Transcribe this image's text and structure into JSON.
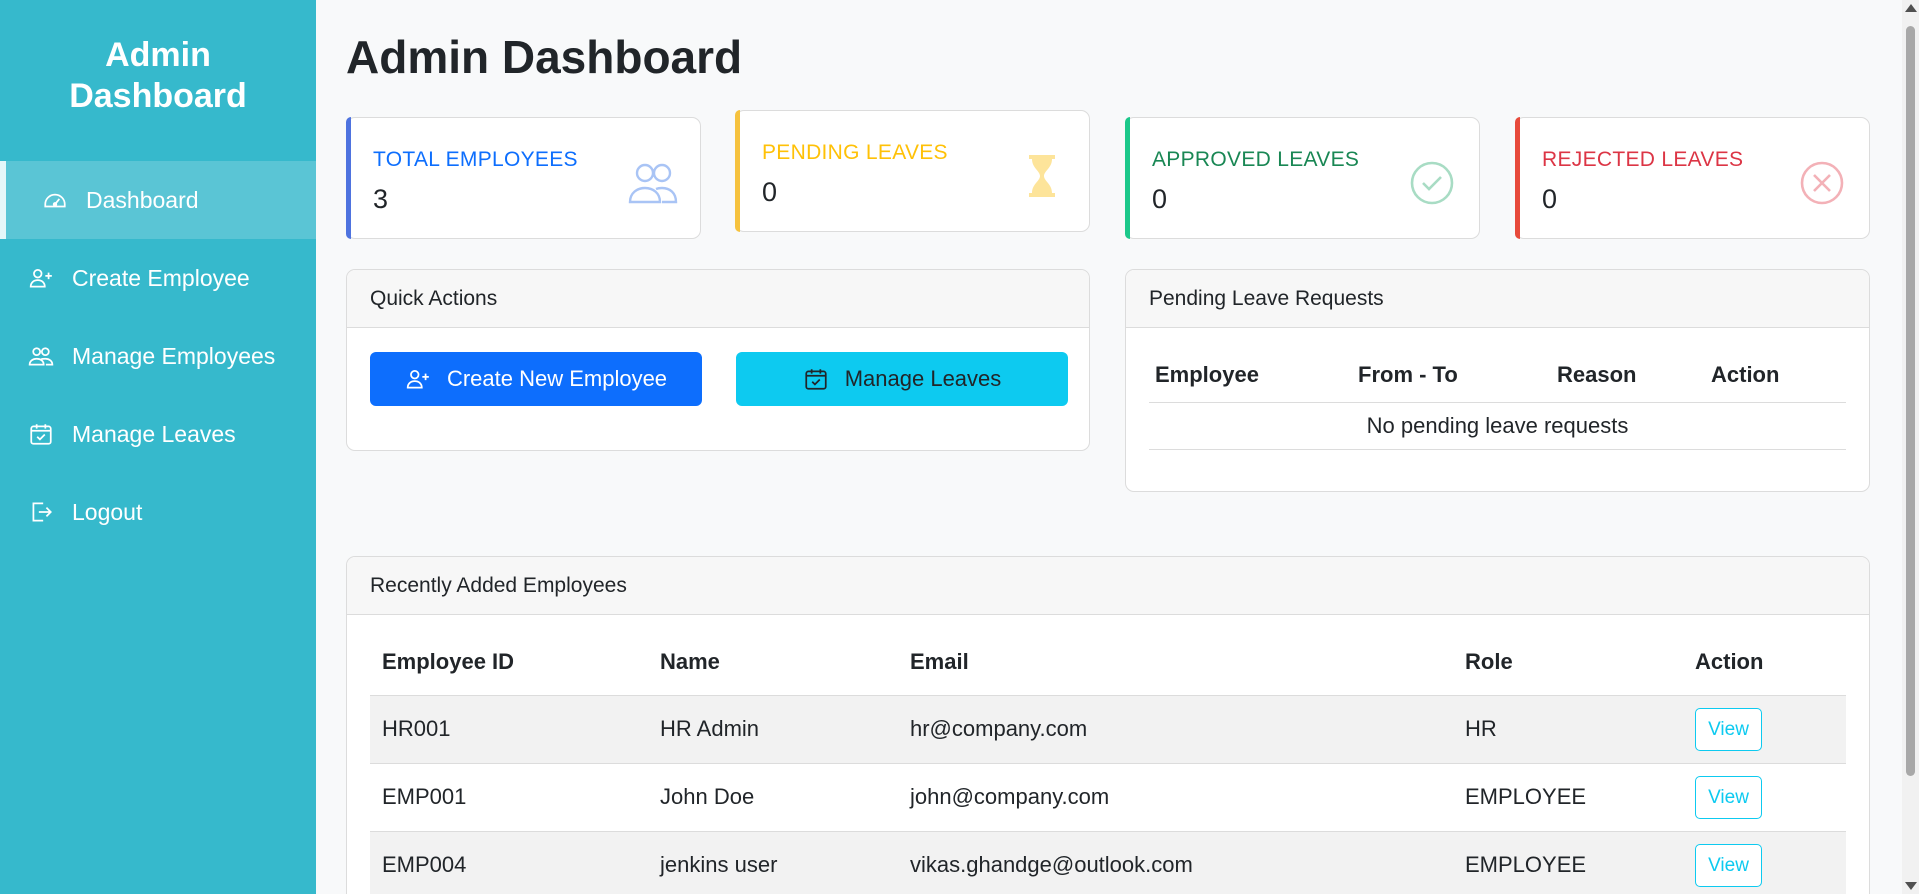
{
  "sidebar": {
    "brand_line1": "Admin",
    "brand_line2": "Dashboard",
    "items": [
      {
        "label": "Dashboard",
        "icon": "speedometer-icon"
      },
      {
        "label": "Create Employee",
        "icon": "person-plus-icon"
      },
      {
        "label": "Manage Employees",
        "icon": "people-icon"
      },
      {
        "label": "Manage Leaves",
        "icon": "calendar-check-icon"
      },
      {
        "label": "Logout",
        "icon": "box-arrow-right-icon"
      }
    ]
  },
  "page_title": "Admin Dashboard",
  "stats": [
    {
      "label": "TOTAL EMPLOYEES",
      "value": "3",
      "color": "#0d6efd",
      "icon": "people-icon"
    },
    {
      "label": "PENDING LEAVES",
      "value": "0",
      "color": "#ffc107",
      "icon": "hourglass-icon"
    },
    {
      "label": "APPROVED LEAVES",
      "value": "0",
      "color": "#198754",
      "icon": "check-circle-icon"
    },
    {
      "label": "REJECTED LEAVES",
      "value": "0",
      "color": "#dc3545",
      "icon": "x-circle-icon"
    }
  ],
  "quick_actions": {
    "title": "Quick Actions",
    "create_label": "Create New Employee",
    "manage_label": "Manage Leaves"
  },
  "pending_requests": {
    "title": "Pending Leave Requests",
    "columns": [
      "Employee",
      "From - To",
      "Reason",
      "Action"
    ],
    "empty_message": "No pending leave requests"
  },
  "recent_employees": {
    "title": "Recently Added Employees",
    "columns": [
      "Employee ID",
      "Name",
      "Email",
      "Role",
      "Action"
    ],
    "rows": [
      {
        "id": "HR001",
        "name": "HR Admin",
        "email": "hr@company.com",
        "role": "HR",
        "action": "View"
      },
      {
        "id": "EMP001",
        "name": "John Doe",
        "email": "john@company.com",
        "role": "EMPLOYEE",
        "action": "View"
      },
      {
        "id": "EMP004",
        "name": "jenkins user",
        "email": "vikas.ghandge@outlook.com",
        "role": "EMPLOYEE",
        "action": "View"
      }
    ]
  },
  "colors": {
    "sidebar_bg": "#36b9cc",
    "primary": "#0d6efd",
    "info": "#0dcaf0"
  }
}
